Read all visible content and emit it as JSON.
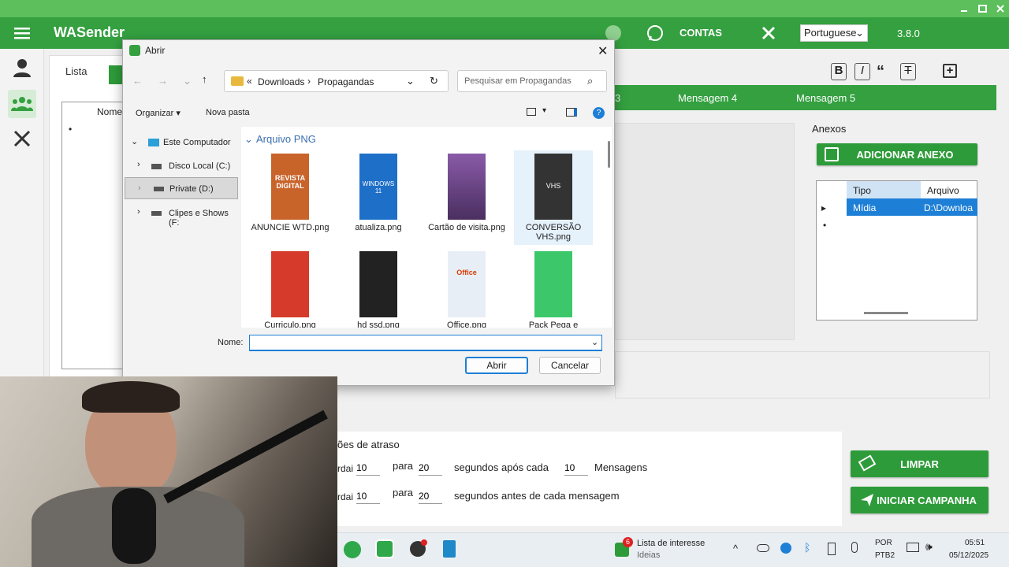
{
  "app": {
    "title": "WASender",
    "accounts_label": "CONTAS",
    "language": "Portuguese",
    "version": "3.8.0",
    "window_controls": [
      "minimize-icon",
      "maximize-icon",
      "close-icon"
    ]
  },
  "main": {
    "tab_list": "Lista",
    "list_header": "Nome",
    "message_tabs": [
      "3",
      "Mensagem 4",
      "Mensagem 5"
    ],
    "attachments": {
      "title": "Anexos",
      "add_button": "ADICIONAR ANEXO",
      "columns": [
        "Tipo",
        "Arquivo"
      ],
      "rows": [
        {
          "tipo": "Mídia",
          "arquivo": "D:\\Downloa"
        }
      ]
    },
    "delay": {
      "title": "ões de atraso",
      "row1": {
        "prefix": "rdai",
        "from": "10",
        "to_label": "para",
        "to": "20",
        "text": "segundos após cada",
        "count": "10",
        "suffix": "Mensagens"
      },
      "row2": {
        "prefix": "rdai",
        "from": "10",
        "to_label": "para",
        "to": "20",
        "text": "segundos antes de cada mensagem"
      }
    },
    "clear_button": "LIMPAR",
    "start_button": "INICIAR CAMPANHA"
  },
  "dialog": {
    "title": "Abrir",
    "breadcrumb": [
      "Downloads",
      "Propagandas"
    ],
    "search_placeholder": "Pesquisar em Propagandas",
    "organize": "Organizar",
    "new_folder": "Nova pasta",
    "tree": [
      {
        "label": "Este Computador"
      },
      {
        "label": "Disco Local (C:)"
      },
      {
        "label": "Private (D:)"
      },
      {
        "label": "Clipes e Shows (F:"
      }
    ],
    "group_label": "Arquivo PNG",
    "files": [
      {
        "name": "ANUNCIE WTD.png",
        "thumb_text": "REVISTA DIGITAL",
        "color": "#c8632a"
      },
      {
        "name": "atualiza.png",
        "thumb_text": "WINDOWS 11",
        "color": "#1e6fc8"
      },
      {
        "name": "Cartão de visita.png",
        "thumb_text": "",
        "color": "#6b3a8c"
      },
      {
        "name": "CONVERSÃO VHS.png",
        "thumb_text": "VHS",
        "color": "#333333"
      },
      {
        "name": "Curriculo.png",
        "thumb_text": "",
        "color": "#d63a2a"
      },
      {
        "name": "hd ssd.png",
        "thumb_text": "",
        "color": "#222222"
      },
      {
        "name": "Office.png",
        "thumb_text": "Office",
        "color": "#e8eef6"
      },
      {
        "name": "Pack Pega e",
        "thumb_text": "",
        "color": "#3cc86a"
      }
    ],
    "name_label": "Nome:",
    "name_value": "",
    "open_button": "Abrir",
    "cancel_button": "Cancelar"
  },
  "taskbar": {
    "notification": "Lista de interesse",
    "notification_sub": "Ideias",
    "badge": "6",
    "lang1": "POR",
    "lang2": "PTB2",
    "time": "05:51",
    "date": "05/12/2025"
  }
}
